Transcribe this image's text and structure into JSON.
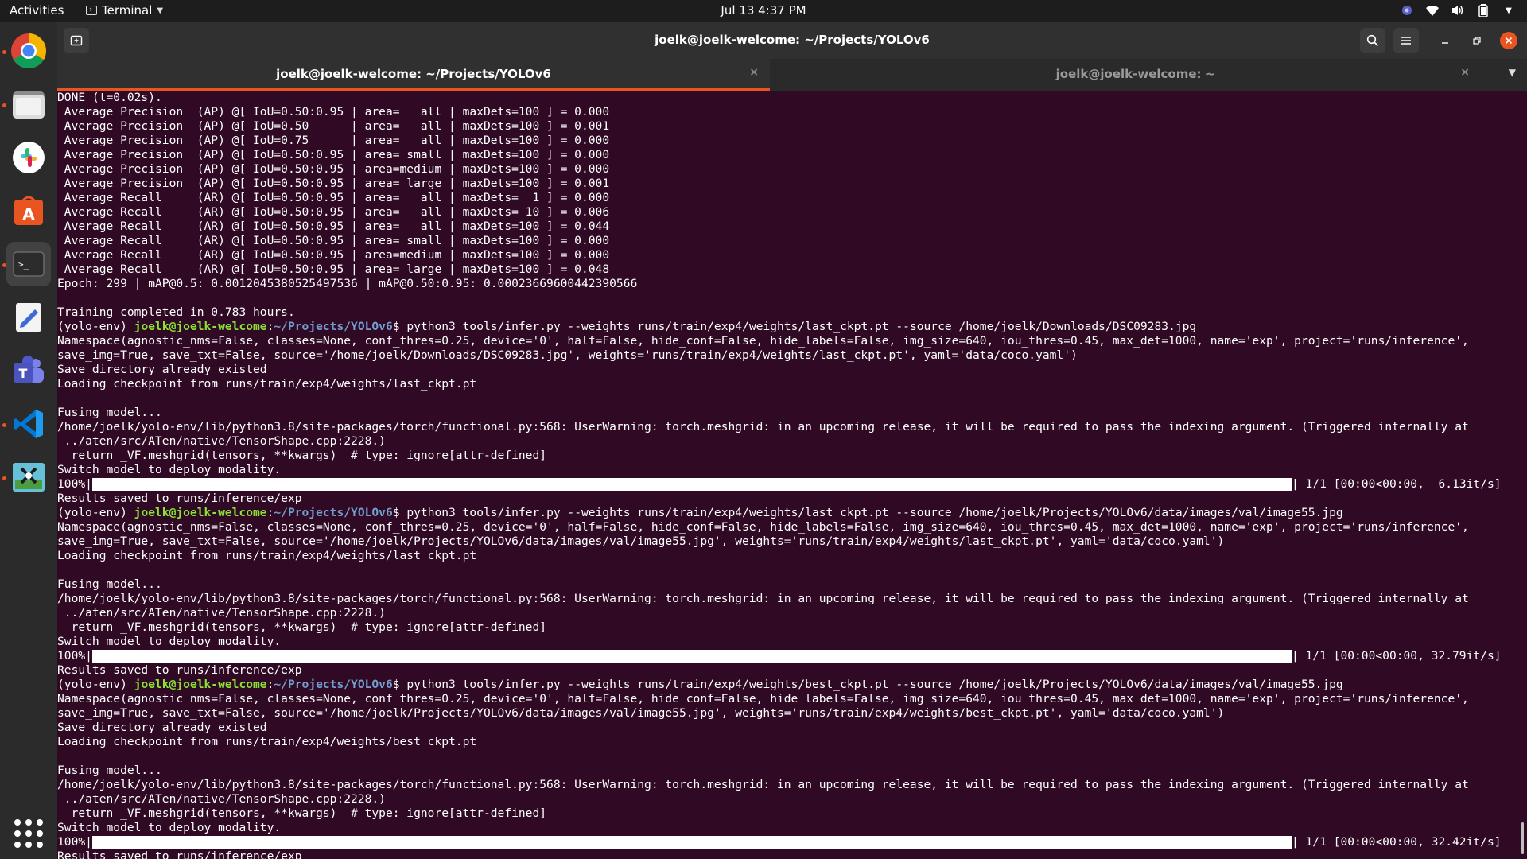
{
  "topbar": {
    "activities": "Activities",
    "app_name": "Terminal",
    "clock": "Jul 13  4:37 PM",
    "tray_icons": [
      "teams-status-icon",
      "wifi-icon",
      "volume-icon",
      "battery-icon",
      "chevron-down-icon"
    ]
  },
  "dock": {
    "items": [
      "chrome",
      "files",
      "slack",
      "software",
      "terminal",
      "text-editor",
      "teams",
      "vscode",
      "screenshot-tool"
    ],
    "accent": "#e95420"
  },
  "window": {
    "title": "joelk@joelk-welcome: ~/Projects/YOLOv6"
  },
  "tabs": [
    {
      "label": "joelk@joelk-welcome: ~/Projects/YOLOv6",
      "close": "×"
    },
    {
      "label": "joelk@joelk-welcome: ~",
      "close": "×"
    }
  ],
  "terminal": {
    "prompt": {
      "env": "(yolo-env) ",
      "user": "joelk@joelk-welcome",
      "path": "~/Projects/YOLOv6",
      "symbol": "$ "
    },
    "colors": {
      "background": "#300a24",
      "user": "#8ae234",
      "path": "#729fcf"
    },
    "lines": [
      "DONE (t=0.02s).",
      " Average Precision  (AP) @[ IoU=0.50:0.95 | area=   all | maxDets=100 ] = 0.000",
      " Average Precision  (AP) @[ IoU=0.50      | area=   all | maxDets=100 ] = 0.001",
      " Average Precision  (AP) @[ IoU=0.75      | area=   all | maxDets=100 ] = 0.000",
      " Average Precision  (AP) @[ IoU=0.50:0.95 | area= small | maxDets=100 ] = 0.000",
      " Average Precision  (AP) @[ IoU=0.50:0.95 | area=medium | maxDets=100 ] = 0.000",
      " Average Precision  (AP) @[ IoU=0.50:0.95 | area= large | maxDets=100 ] = 0.001",
      " Average Recall     (AR) @[ IoU=0.50:0.95 | area=   all | maxDets=  1 ] = 0.000",
      " Average Recall     (AR) @[ IoU=0.50:0.95 | area=   all | maxDets= 10 ] = 0.006",
      " Average Recall     (AR) @[ IoU=0.50:0.95 | area=   all | maxDets=100 ] = 0.044",
      " Average Recall     (AR) @[ IoU=0.50:0.95 | area= small | maxDets=100 ] = 0.000",
      " Average Recall     (AR) @[ IoU=0.50:0.95 | area=medium | maxDets=100 ] = 0.000",
      " Average Recall     (AR) @[ IoU=0.50:0.95 | area= large | maxDets=100 ] = 0.048",
      "Epoch: 299 | mAP@0.5: 0.0012045380525497536 | mAP@0.50:0.95: 0.00023669600442390566",
      "",
      "Training completed in 0.783 hours.",
      {
        "prompt": true,
        "cmd": "python3 tools/infer.py --weights runs/train/exp4/weights/last_ckpt.pt --source /home/joelk/Downloads/DSC09283.jpg"
      },
      "Namespace(agnostic_nms=False, classes=None, conf_thres=0.25, device='0', half=False, hide_conf=False, hide_labels=False, img_size=640, iou_thres=0.45, max_det=1000, name='exp', project='runs/inference',",
      "save_img=True, save_txt=False, source='/home/joelk/Downloads/DSC09283.jpg', weights='runs/train/exp4/weights/last_ckpt.pt', yaml='data/coco.yaml')",
      "Save directory already existed",
      "Loading checkpoint from runs/train/exp4/weights/last_ckpt.pt",
      "",
      "Fusing model...",
      "/home/joelk/yolo-env/lib/python3.8/site-packages/torch/functional.py:568: UserWarning: torch.meshgrid: in an upcoming release, it will be required to pass the indexing argument. (Triggered internally at",
      " ../aten/src/ATen/native/TensorShape.cpp:2228.)",
      "  return _VF.meshgrid(tensors, **kwargs)  # type: ignore[attr-defined]",
      "Switch model to deploy modality.",
      {
        "progress": true,
        "pct": "100%|",
        "stats": "| 1/1 [00:00<00:00,  6.13it/s]"
      },
      "Results saved to runs/inference/exp",
      {
        "prompt": true,
        "cmd": "python3 tools/infer.py --weights runs/train/exp4/weights/last_ckpt.pt --source /home/joelk/Projects/YOLOv6/data/images/val/image55.jpg"
      },
      "Namespace(agnostic_nms=False, classes=None, conf_thres=0.25, device='0', half=False, hide_conf=False, hide_labels=False, img_size=640, iou_thres=0.45, max_det=1000, name='exp', project='runs/inference',",
      "save_img=True, save_txt=False, source='/home/joelk/Projects/YOLOv6/data/images/val/image55.jpg', weights='runs/train/exp4/weights/last_ckpt.pt', yaml='data/coco.yaml')",
      "Loading checkpoint from runs/train/exp4/weights/last_ckpt.pt",
      "",
      "Fusing model...",
      "/home/joelk/yolo-env/lib/python3.8/site-packages/torch/functional.py:568: UserWarning: torch.meshgrid: in an upcoming release, it will be required to pass the indexing argument. (Triggered internally at",
      " ../aten/src/ATen/native/TensorShape.cpp:2228.)",
      "  return _VF.meshgrid(tensors, **kwargs)  # type: ignore[attr-defined]",
      "Switch model to deploy modality.",
      {
        "progress": true,
        "pct": "100%|",
        "stats": "| 1/1 [00:00<00:00, 32.79it/s]"
      },
      "Results saved to runs/inference/exp",
      {
        "prompt": true,
        "cmd": "python3 tools/infer.py --weights runs/train/exp4/weights/best_ckpt.pt --source /home/joelk/Projects/YOLOv6/data/images/val/image55.jpg"
      },
      "Namespace(agnostic_nms=False, classes=None, conf_thres=0.25, device='0', half=False, hide_conf=False, hide_labels=False, img_size=640, iou_thres=0.45, max_det=1000, name='exp', project='runs/inference',",
      "save_img=True, save_txt=False, source='/home/joelk/Projects/YOLOv6/data/images/val/image55.jpg', weights='runs/train/exp4/weights/best_ckpt.pt', yaml='data/coco.yaml')",
      "Save directory already existed",
      "Loading checkpoint from runs/train/exp4/weights/best_ckpt.pt",
      "",
      "Fusing model...",
      "/home/joelk/yolo-env/lib/python3.8/site-packages/torch/functional.py:568: UserWarning: torch.meshgrid: in an upcoming release, it will be required to pass the indexing argument. (Triggered internally at",
      " ../aten/src/ATen/native/TensorShape.cpp:2228.)",
      "  return _VF.meshgrid(tensors, **kwargs)  # type: ignore[attr-defined]",
      "Switch model to deploy modality.",
      {
        "progress": true,
        "pct": "100%|",
        "stats": "| 1/1 [00:00<00:00, 32.42it/s]"
      },
      "Results saved to runs/inference/exp"
    ]
  }
}
